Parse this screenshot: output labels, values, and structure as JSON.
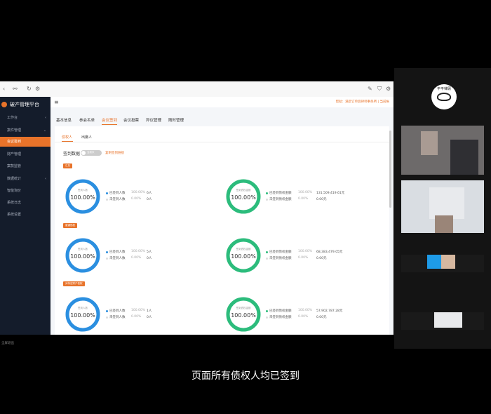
{
  "app": {
    "title": "破产管理平台"
  },
  "subtitle": "页面所有债权人均已签到",
  "statusbar": "全屏退出",
  "topbar": {
    "right_text": "帮助：满足订单后律师事务所 | 当前帐"
  },
  "avatar": {
    "label": "平平律顾"
  },
  "sidebar": {
    "items": [
      {
        "label": "工作台",
        "arrow": "‹"
      },
      {
        "label": "案件管理",
        "arrow": "⌄"
      },
      {
        "label": "会议签到"
      },
      {
        "label": "财产管理"
      },
      {
        "label": "案款监管"
      },
      {
        "label": "数据统计",
        "arrow": "‹"
      },
      {
        "label": "智能询价"
      },
      {
        "label": "系统日志"
      },
      {
        "label": "系统设置"
      }
    ]
  },
  "tabs": [
    "基本信息",
    "参会名单",
    "会议签到",
    "会议投票",
    "异议管理",
    "随时管理"
  ],
  "subtabs": [
    "债权人",
    "出席人"
  ],
  "toggle": {
    "label": "签到数据",
    "switch_text": "当前未",
    "link": "复制签到链接"
  },
  "sections": [
    {
      "tag": "汇总",
      "left": {
        "ring_label": "签到人数",
        "ring_value": "100.00%",
        "rows": [
          {
            "name": "已签到人数",
            "pct": "100.00%",
            "val": "6人"
          },
          {
            "name": "未签到人数",
            "pct": "0.00%",
            "val": "0人"
          }
        ]
      },
      "right": {
        "ring_label": "签到债权金额",
        "ring_value": "100.00%",
        "rows": [
          {
            "name": "已签到债权金额",
            "pct": "100.00%",
            "val": "131,509,419.61元"
          },
          {
            "name": "未签到债权金额",
            "pct": "0.00%",
            "val": "0.00元"
          }
        ]
      }
    },
    {
      "tag": "普通债权",
      "left": {
        "ring_label": "签到人数",
        "ring_value": "100.00%",
        "rows": [
          {
            "name": "已签到人数",
            "pct": "100.00%",
            "val": "5人"
          },
          {
            "name": "未签到人数",
            "pct": "0.00%",
            "val": "0人"
          }
        ]
      },
      "right": {
        "ring_label": "签到债权金额",
        "ring_value": "100.00%",
        "rows": [
          {
            "name": "已签到债权金额",
            "pct": "100.00%",
            "val": "68,383,479.05元"
          },
          {
            "name": "未签到债权金额",
            "pct": "0.00%",
            "val": "0.00元"
          }
        ]
      }
    },
    {
      "tag": "对特定财产债权",
      "left": {
        "ring_label": "签到人数",
        "ring_value": "100.00%",
        "rows": [
          {
            "name": "已签到人数",
            "pct": "100.00%",
            "val": "1人"
          },
          {
            "name": "未签到人数",
            "pct": "0.00%",
            "val": "0人"
          }
        ]
      },
      "right": {
        "ring_label": "签到债权金额",
        "ring_value": "100.00%",
        "rows": [
          {
            "name": "已签到债权金额",
            "pct": "100.00%",
            "val": "57,902,787.28元"
          },
          {
            "name": "未签到债权金额",
            "pct": "0.00%",
            "val": "0.00元"
          }
        ]
      }
    }
  ],
  "colors": {
    "accent": "#e8732a",
    "ring_blue": "#2b8fe0",
    "ring_green": "#2cbc7c",
    "sidebar_bg": "#141c2b"
  }
}
